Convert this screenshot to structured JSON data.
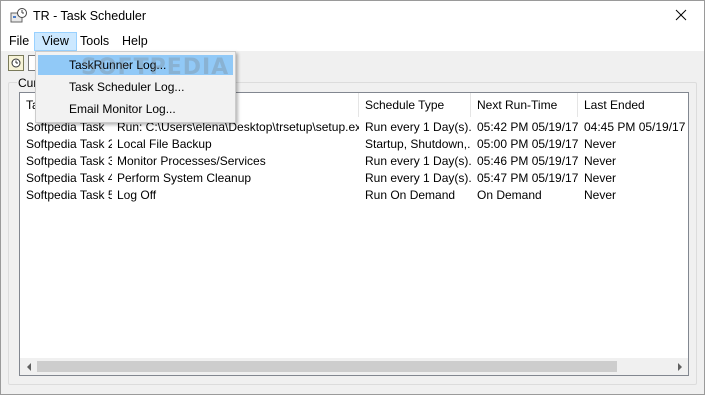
{
  "window": {
    "title": "TR - Task Scheduler"
  },
  "menu": {
    "items": [
      {
        "label": "File"
      },
      {
        "label": "View"
      },
      {
        "label": "Tools"
      },
      {
        "label": "Help"
      }
    ]
  },
  "view_menu": {
    "items": [
      {
        "label": "TaskRunner Log..."
      },
      {
        "label": "Task Scheduler Log..."
      },
      {
        "label": "Email Monitor Log..."
      }
    ]
  },
  "group": {
    "label": "Cur"
  },
  "table": {
    "columns": [
      {
        "label": "Ta"
      },
      {
        "label": ""
      },
      {
        "label": "Schedule Type"
      },
      {
        "label": "Next Run-Time"
      },
      {
        "label": "Last Ended"
      }
    ],
    "rows": [
      {
        "name": "Softpedia Task",
        "action": "Run: C:\\Users\\elena\\Desktop\\trsetup\\setup.exe",
        "schedule": "Run every 1 Day(s).",
        "next": "05:42 PM 05/19/17",
        "last": "04:45 PM 05/19/17"
      },
      {
        "name": "Softpedia Task 2",
        "action": "Local File Backup",
        "schedule": "Startup, Shutdown,...",
        "next": "05:00 PM 05/19/17",
        "last": "Never"
      },
      {
        "name": "Softpedia Task 3",
        "action": "Monitor Processes/Services",
        "schedule": "Run every 1 Day(s).",
        "next": "05:46 PM 05/19/17",
        "last": "Never"
      },
      {
        "name": "Softpedia Task 4",
        "action": "Perform System Cleanup",
        "schedule": "Run every 1 Day(s).",
        "next": "05:47 PM 05/19/17",
        "last": "Never"
      },
      {
        "name": "Softpedia Task 5",
        "action": "Log Off",
        "schedule": "Run On Demand",
        "next": "On Demand",
        "last": "Never"
      }
    ]
  },
  "watermark": {
    "text": "SOFTPEDIA"
  },
  "icons": {
    "app": "scheduler-app-icon",
    "close": "close-icon",
    "toolbar": "toolbar-action-icon",
    "scroll_left": "chevron-left-icon",
    "scroll_right": "chevron-right-icon"
  }
}
